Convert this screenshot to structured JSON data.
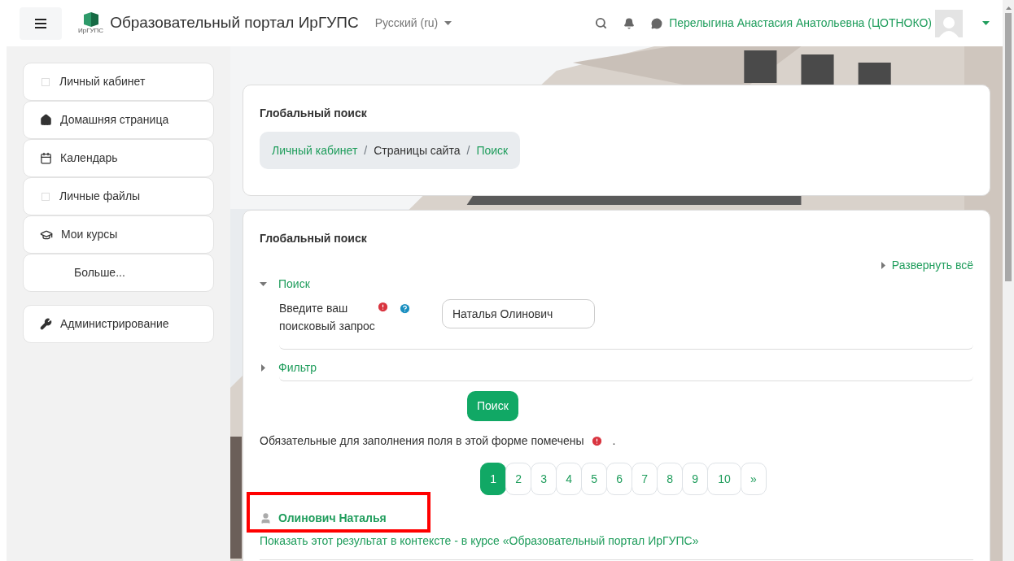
{
  "header": {
    "site_title": "Образовательный портал ИрГУПС",
    "logo_caption": "ИрГУПС",
    "language": "Русский (ru)",
    "user_name": "Перелыгина Анастасия Анатольевна (ЦОТНОКО)"
  },
  "sidebar": {
    "items": [
      {
        "label": "Личный кабинет",
        "kind": "blank"
      },
      {
        "label": "Домашняя страница",
        "kind": "home"
      },
      {
        "label": "Календарь",
        "kind": "calendar"
      },
      {
        "label": "Личные файлы",
        "kind": "blank"
      },
      {
        "label": "Мои курсы",
        "kind": "courses"
      },
      {
        "label": "Больше...",
        "kind": "more"
      }
    ],
    "admin": {
      "label": "Администрирование"
    }
  },
  "header_card": {
    "title": "Глобальный поиск",
    "breadcrumb": [
      {
        "label": "Личный кабинет",
        "link": true
      },
      {
        "label": "Страницы сайта",
        "link": false
      },
      {
        "label": "Поиск",
        "link": true
      }
    ],
    "separator": "/"
  },
  "search_card": {
    "title": "Глобальный поиск",
    "expand_all": "Развернуть всё",
    "sections": [
      {
        "label": "Поиск",
        "expanded": true
      },
      {
        "label": "Фильтр",
        "expanded": false
      }
    ],
    "field": {
      "label": "Введите ваш поисковый запрос",
      "required": true,
      "value": "Наталья Олинович"
    },
    "submit": "Поиск",
    "required_note": "Обязательные для заполнения поля в этой форме помечены",
    "required_note_end": ".",
    "pagination": [
      {
        "label": "1",
        "selected": true
      },
      {
        "label": "2",
        "selected": false
      },
      {
        "label": "3",
        "selected": false
      },
      {
        "label": "4",
        "selected": false
      },
      {
        "label": "5",
        "selected": false
      },
      {
        "label": "6",
        "selected": false
      },
      {
        "label": "7",
        "selected": false
      },
      {
        "label": "8",
        "selected": false
      },
      {
        "label": "9",
        "selected": false
      },
      {
        "label": "10",
        "selected": false
      },
      {
        "label": "»",
        "selected": false
      }
    ],
    "results": [
      {
        "title": "Олинович Наталья",
        "highlighted": true,
        "context_link": "Показать этот результат в контексте - в курсе «Образовательный портал ИрГУПС»"
      }
    ]
  }
}
